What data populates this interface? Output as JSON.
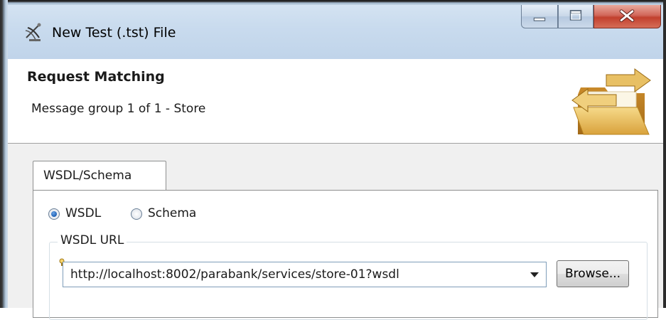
{
  "window": {
    "title": "New Test (.tst) File",
    "title_icon": "satellite-dish-icon",
    "controls": {
      "minimize_icon": "minimize-icon",
      "maximize_icon": "maximize-icon",
      "close_icon": "close-icon",
      "close_color": "#c2402e"
    }
  },
  "header": {
    "title": "Request Matching",
    "subtitle": "Message group 1 of 1 - Store",
    "icon": "folder-exchange-icon"
  },
  "tabs": [
    {
      "label": "WSDL/Schema",
      "selected": true
    }
  ],
  "source_options": [
    {
      "label": "WSDL",
      "checked": true
    },
    {
      "label": "Schema",
      "checked": false
    }
  ],
  "wsdl_group": {
    "legend": "WSDL URL",
    "url_value": "http://localhost:8002/parabank/services/store-01?wsdl",
    "browse_label": "Browse..."
  },
  "colors": {
    "titlebar": "#c9dbee",
    "content_bg": "#f0f0f0",
    "radio_selected": "#1d5fb4"
  }
}
